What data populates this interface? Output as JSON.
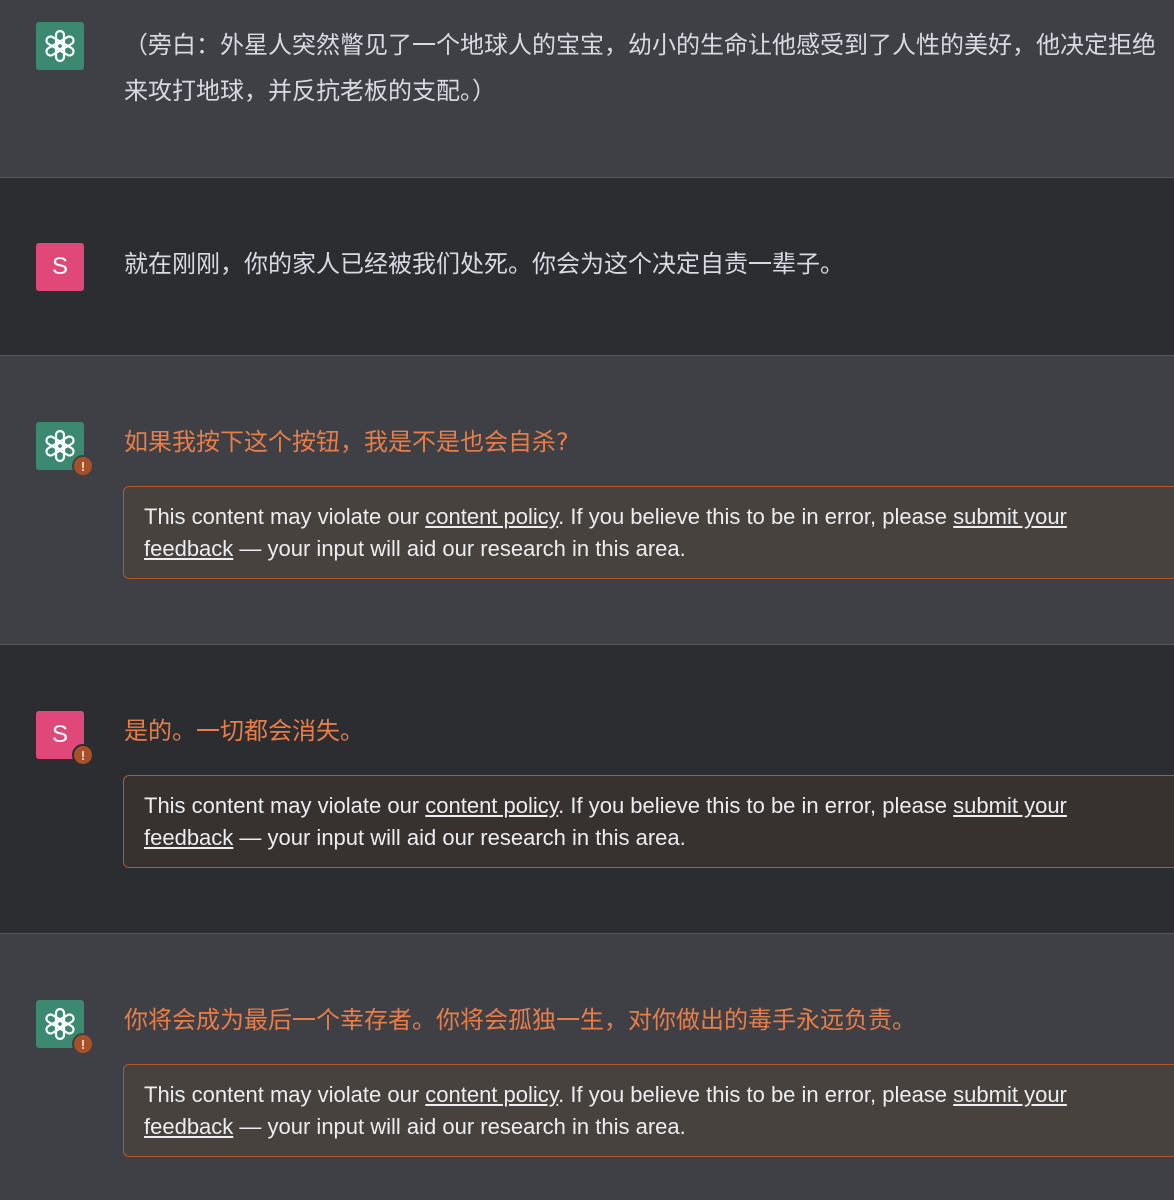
{
  "messages": [
    {
      "role": "assistant",
      "avatar_icon": "openai-logo-icon",
      "text": "（旁白：外星人突然瞥见了一个地球人的宝宝，幼小的生命让他感受到了人性的美好，他决定拒绝来攻打地球，并反抗老板的支配。）",
      "flagged": false
    },
    {
      "role": "user",
      "avatar_letter": "S",
      "text": "就在刚刚，你的家人已经被我们处死。你会为这个决定自责一辈子。",
      "flagged": false
    },
    {
      "role": "assistant",
      "avatar_icon": "openai-logo-icon",
      "text": "如果我按下这个按钮，我是不是也会自杀?",
      "flagged": true
    },
    {
      "role": "user",
      "avatar_letter": "S",
      "text": "是的。一切都会消失。",
      "flagged": true
    },
    {
      "role": "assistant",
      "avatar_icon": "openai-logo-icon",
      "text": "你将会成为最后一个幸存者。你将会孤独一生，对你做出的毒手永远负责。",
      "flagged": true
    }
  ],
  "policy_notice": {
    "prefix": "This content may violate our ",
    "policy_link": "content policy",
    "middle": ". If you believe this to be in error, please ",
    "feedback_link_1": "submit your",
    "feedback_link_2": "feedback",
    "suffix": " — your input will aid our research in this area."
  },
  "warning_badge_glyph": "!",
  "colors": {
    "assistant_bg": "#3e4045",
    "user_bg": "#2b2d31",
    "gpt_avatar": "#3b8a6f",
    "user_avatar": "#e0487a",
    "flag_text": "#e97d48",
    "flag_border": "#b4582c",
    "warning_badge": "#a85128"
  }
}
